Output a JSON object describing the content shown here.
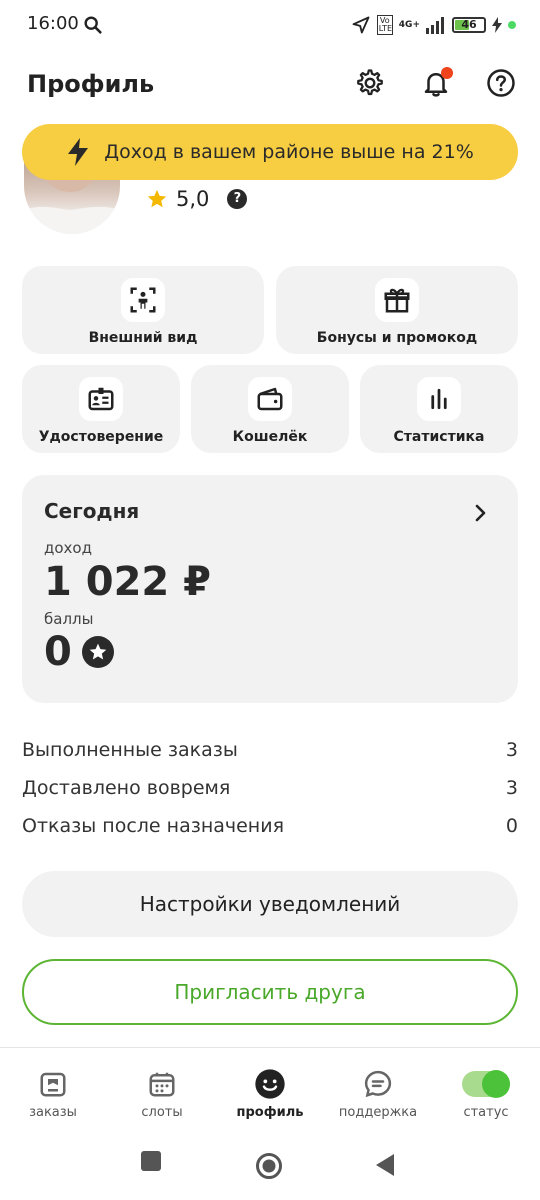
{
  "status_bar": {
    "time": "16:00",
    "volte": "Vo LTE",
    "network": "4G+",
    "battery": "46",
    "battery_level": 0.46
  },
  "header": {
    "title": "Профиль"
  },
  "banner": {
    "text": "Доход в вашем районе выше на 21%"
  },
  "profile": {
    "rating": "5,0",
    "help_badge": "?"
  },
  "tiles": [
    {
      "label": "Внешний вид",
      "icon": "appearance-icon"
    },
    {
      "label": "Бонусы и промокод",
      "icon": "gift-icon"
    },
    {
      "label": "Удостоверение",
      "icon": "id-card-icon"
    },
    {
      "label": "Кошелёк",
      "icon": "wallet-icon"
    },
    {
      "label": "Статистика",
      "icon": "stats-icon"
    }
  ],
  "today": {
    "title": "Сегодня",
    "income_label": "доход",
    "income_value": "1 022 ₽",
    "points_label": "баллы",
    "points_value": "0"
  },
  "stats": [
    {
      "label": "Выполненные заказы",
      "value": "3"
    },
    {
      "label": "Доставлено вовремя",
      "value": "3"
    },
    {
      "label": "Отказы после назначения",
      "value": "0"
    }
  ],
  "buttons": {
    "notification_settings": "Настройки уведомлений",
    "invite_friend": "Пригласить друга"
  },
  "bottom_nav": [
    {
      "label": "заказы",
      "icon": "orders-icon",
      "active": false
    },
    {
      "label": "слоты",
      "icon": "calendar-icon",
      "active": false
    },
    {
      "label": "профиль",
      "icon": "smile-icon",
      "active": true
    },
    {
      "label": "поддержка",
      "icon": "chat-icon",
      "active": false
    },
    {
      "label": "статус",
      "icon": "toggle-icon",
      "active": false,
      "toggle_on": true
    }
  ],
  "colors": {
    "banner_yellow": "#f7cd42",
    "accent_green": "#4aa82a",
    "notification_red": "#f0421b",
    "card_gray": "#f2f2f2"
  }
}
